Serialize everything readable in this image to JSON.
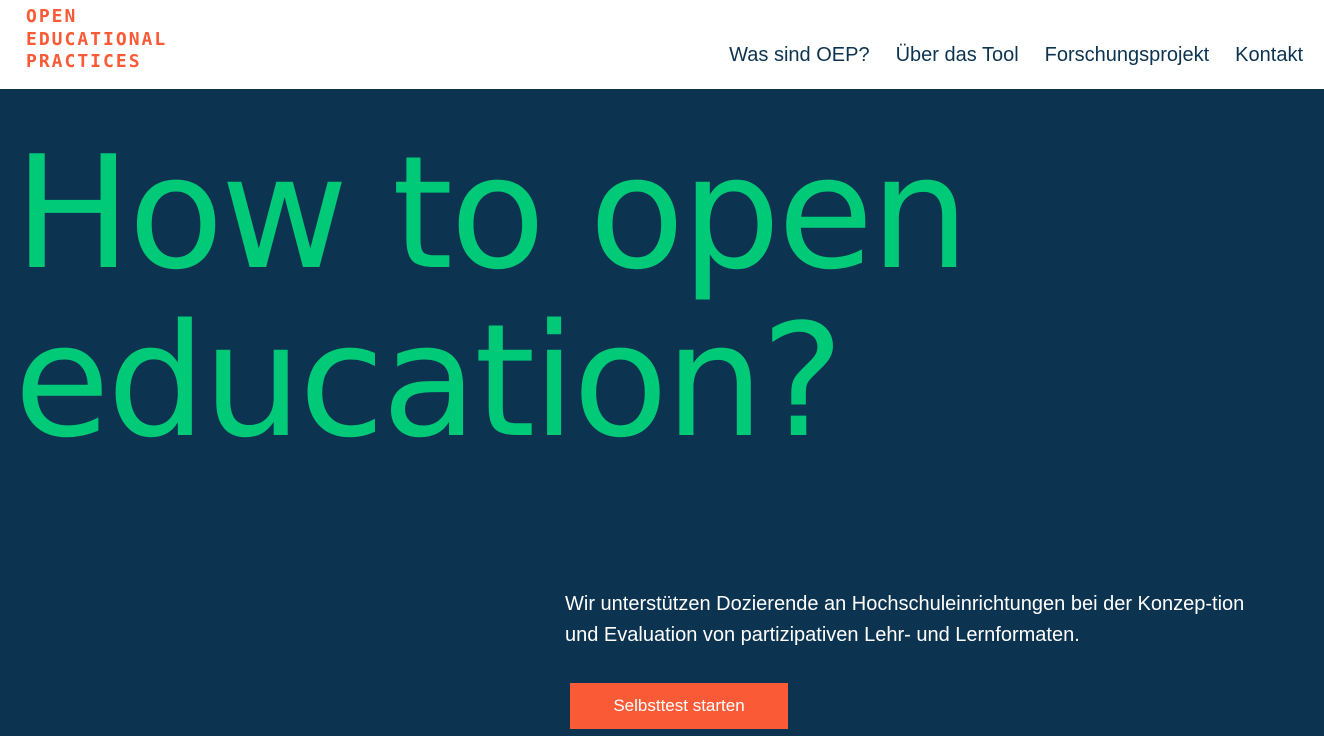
{
  "header": {
    "logo_lines": [
      "OPEN",
      "EDUCATIONAL",
      "PRACTICES"
    ],
    "nav": [
      "Was sind OEP?",
      "Über das Tool",
      "Forschungsprojekt",
      "Kontakt"
    ]
  },
  "hero": {
    "headline_lines": [
      "How to open",
      "education?"
    ],
    "intro": "Wir unterstützen Dozierende an Hochschuleinrichtungen bei der Konzep-tion und Evaluation von partizipativen Lehr- und Lernformaten.",
    "cta_label": "Selbsttest starten"
  },
  "colors": {
    "brand_orange": "#fa5a35",
    "navy": "#0c3350",
    "green": "#00c978",
    "white": "#ffffff"
  }
}
